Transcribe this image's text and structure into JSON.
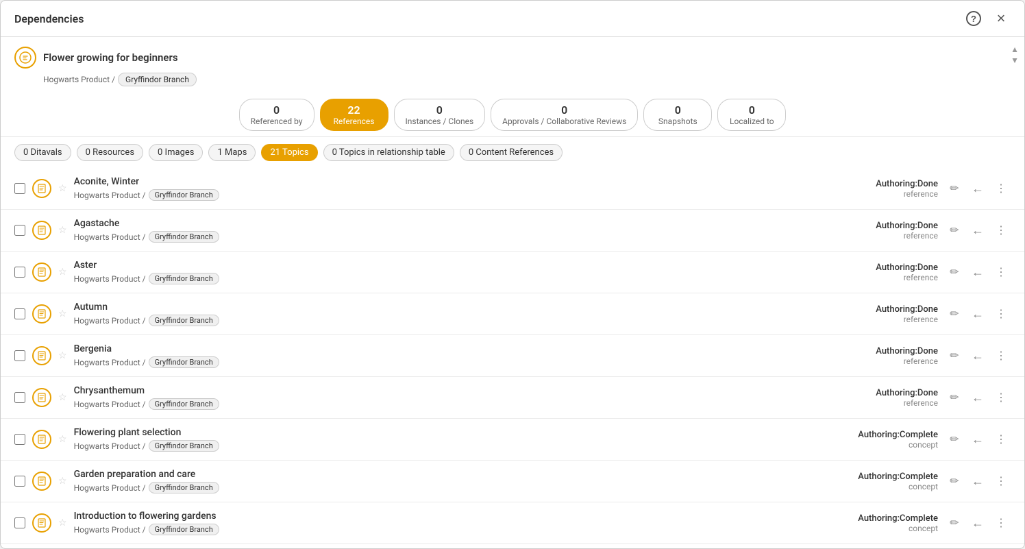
{
  "modal": {
    "title": "Dependencies",
    "help_icon": "?",
    "close_icon": "×"
  },
  "topic": {
    "name": "Flower growing for beginners",
    "breadcrumb_prefix": "Hogwarts Product /",
    "breadcrumb_tag": "Gryffindor Branch"
  },
  "tabs": [
    {
      "id": "referenced-by",
      "count": "0",
      "label": "Referenced by",
      "active": false
    },
    {
      "id": "references",
      "count": "22",
      "label": "References",
      "active": true
    },
    {
      "id": "instances-clones",
      "count": "0",
      "label": "Instances / Clones",
      "active": false
    },
    {
      "id": "approvals",
      "count": "0",
      "label": "Approvals / Collaborative Reviews",
      "active": false
    },
    {
      "id": "snapshots",
      "count": "0",
      "label": "Snapshots",
      "active": false
    },
    {
      "id": "localized-to",
      "count": "0",
      "label": "Localized to",
      "active": false
    }
  ],
  "filters": [
    {
      "id": "ditavals",
      "label": "0 Ditavals",
      "active": false
    },
    {
      "id": "resources",
      "label": "0 Resources",
      "active": false
    },
    {
      "id": "images",
      "label": "0 Images",
      "active": false
    },
    {
      "id": "maps",
      "label": "1 Maps",
      "active": false
    },
    {
      "id": "topics",
      "label": "21 Topics",
      "active": true
    },
    {
      "id": "topics-relationship",
      "label": "0 Topics in relationship table",
      "active": false
    },
    {
      "id": "content-references",
      "label": "0 Content References",
      "active": false
    }
  ],
  "items": [
    {
      "title": "Aconite, Winter",
      "breadcrumb": "Hogwarts Product /",
      "tag": "Gryffindor Branch",
      "status": "Authoring:Done",
      "type": "reference"
    },
    {
      "title": "Agastache",
      "breadcrumb": "Hogwarts Product /",
      "tag": "Gryffindor Branch",
      "status": "Authoring:Done",
      "type": "reference"
    },
    {
      "title": "Aster",
      "breadcrumb": "Hogwarts Product /",
      "tag": "Gryffindor Branch",
      "status": "Authoring:Done",
      "type": "reference"
    },
    {
      "title": "Autumn",
      "breadcrumb": "Hogwarts Product /",
      "tag": "Gryffindor Branch",
      "status": "Authoring:Done",
      "type": "reference"
    },
    {
      "title": "Bergenia",
      "breadcrumb": "Hogwarts Product /",
      "tag": "Gryffindor Branch",
      "status": "Authoring:Done",
      "type": "reference"
    },
    {
      "title": "Chrysanthemum",
      "breadcrumb": "Hogwarts Product /",
      "tag": "Gryffindor Branch",
      "status": "Authoring:Done",
      "type": "reference"
    },
    {
      "title": "Flowering plant selection",
      "breadcrumb": "Hogwarts Product /",
      "tag": "Gryffindor Branch",
      "status": "Authoring:Complete",
      "type": "concept"
    },
    {
      "title": "Garden preparation and care",
      "breadcrumb": "Hogwarts Product /",
      "tag": "Gryffindor Branch",
      "status": "Authoring:Complete",
      "type": "concept"
    },
    {
      "title": "Introduction to flowering gardens",
      "breadcrumb": "Hogwarts Product /",
      "tag": "Gryffindor Branch",
      "status": "Authoring:Complete",
      "type": "concept"
    }
  ],
  "icons": {
    "edit": "✏",
    "back_arrow": "←",
    "more": "⋮",
    "star_empty": "☆",
    "doc": "≡",
    "scroll_up": "▲",
    "scroll_down": "▼"
  }
}
